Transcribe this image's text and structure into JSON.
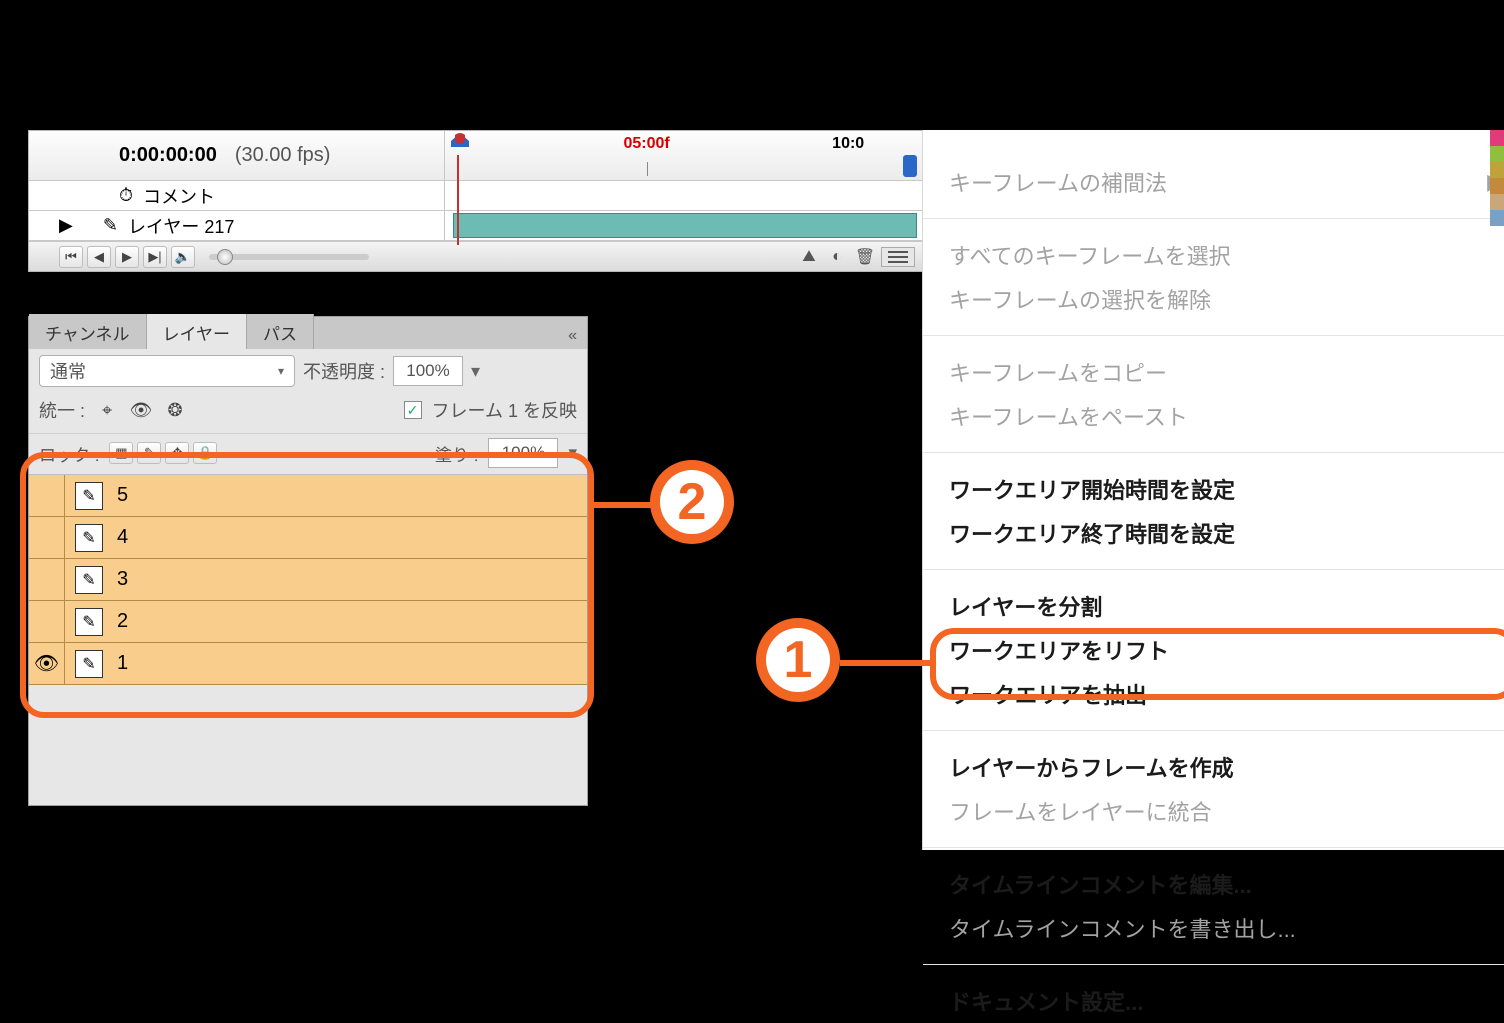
{
  "timeline": {
    "time_display": "0:00:00:00",
    "fps": "(30.00 fps)",
    "marks": {
      "m1": "05:00f",
      "m2": "10:0"
    },
    "row_comment": {
      "icon": "⏱",
      "label": "コメント"
    },
    "row_layer": {
      "icon": "✎",
      "label": "レイヤー 217",
      "expand": "▶"
    }
  },
  "layers_panel": {
    "tabs": {
      "t1": "チャンネル",
      "t2": "レイヤー",
      "t3": "パス"
    },
    "blend_label": "通常",
    "opacity_label": "不透明度 :",
    "opacity_value": "100%",
    "unify_label": "統一 :",
    "frame1_label": "フレーム 1 を反映",
    "lock_label": "ロック :",
    "fill_label": "塗り :",
    "fill_value": "100%",
    "rows": [
      {
        "name": "5",
        "eye": ""
      },
      {
        "name": "4",
        "eye": ""
      },
      {
        "name": "3",
        "eye": ""
      },
      {
        "name": "2",
        "eye": ""
      },
      {
        "name": "1",
        "eye": "👁"
      }
    ]
  },
  "menu": {
    "keyframe_interp": "キーフレームの補間法",
    "select_all_keys": "すべてのキーフレームを選択",
    "deselect_keys": "キーフレームの選択を解除",
    "copy_keys": "キーフレームをコピー",
    "paste_keys": "キーフレームをペースト",
    "set_start": "ワークエリア開始時間を設定",
    "set_end": "ワークエリア終了時間を設定",
    "split_layer": "レイヤーを分割",
    "lift_wa": "ワークエリアをリフト",
    "extract_wa": "ワークエリアを抽出",
    "frames_from_layers": "レイヤーからフレームを作成",
    "frames_merge": "フレームをレイヤーに統合",
    "edit_comment": "タイムラインコメントを編集...",
    "export_comment": "タイムラインコメントを書き出し...",
    "doc_settings": "ドキュメント設定..."
  },
  "callouts": {
    "c1": "1",
    "c2": "2"
  },
  "colors": {
    "accent": "#f26522",
    "strip": [
      "#e23b7a",
      "#8fbf3f",
      "#bfa23a",
      "#c48a3b",
      "#caa77a",
      "#7aa0c4"
    ]
  }
}
